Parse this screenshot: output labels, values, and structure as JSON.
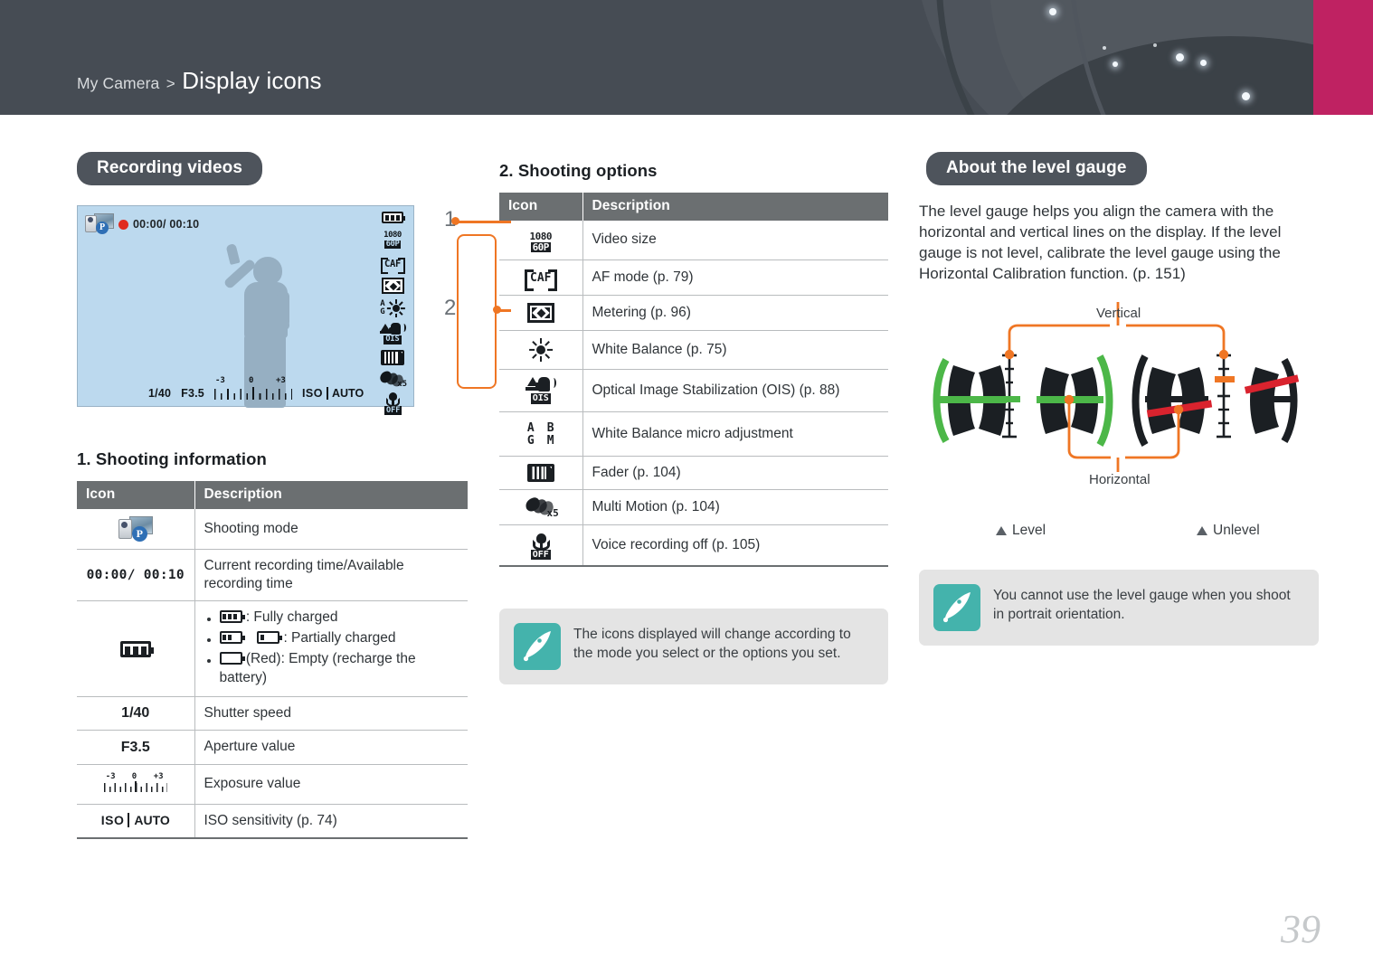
{
  "header": {
    "breadcrumb_parent": "My Camera",
    "breadcrumb_separator": ">",
    "breadcrumb_current": "Display icons",
    "bg_color": "#464c54",
    "accent_color": "#bf2262"
  },
  "page_number": "39",
  "col1": {
    "section_pill": "Recording videos",
    "lcd": {
      "rec_time": "00:00/ 00:10",
      "mode_badge": "P",
      "shutter": "1/40",
      "aperture": "F3.5",
      "ev_labels": [
        "-3",
        "0",
        "+3"
      ],
      "iso_prefix": "ISO",
      "iso_value": "AUTO",
      "right_icons": [
        "battery-icon",
        "video-size-1080-60p-icon",
        "af-mode-caf-icon",
        "metering-icon",
        "white-balance-daylight-icon",
        "ois-icon",
        "fader-icon",
        "multi-motion-x5-icon",
        "voice-recording-off-icon"
      ]
    },
    "callouts": [
      {
        "number": "1",
        "target": "battery-icon"
      },
      {
        "number": "2",
        "target": "shooting-options-icon-group"
      }
    ],
    "callout_color": "#ef7624",
    "subhead": "1. Shooting information",
    "table": {
      "headers": [
        "Icon",
        "Description"
      ],
      "rows": [
        {
          "icon": "shooting-mode-icon",
          "icon_text": "",
          "description": "Shooting mode"
        },
        {
          "icon": "recording-time-text",
          "icon_text": "00:00/ 00:10",
          "description": "Current recording time/Available recording time"
        },
        {
          "icon": "battery-icon",
          "icon_text": "",
          "bullets": [
            {
              "icons": [
                "battery-full-icon"
              ],
              "text": ": Fully charged"
            },
            {
              "icons": [
                "battery-mid-icon",
                "battery-low-icon"
              ],
              "text": ": Partially charged"
            },
            {
              "icons": [
                "battery-empty-icon"
              ],
              "text": "(Red): Empty (recharge the battery)"
            }
          ]
        },
        {
          "icon": "shutter-speed-text",
          "icon_text": "1/40",
          "description": "Shutter speed"
        },
        {
          "icon": "aperture-value-text",
          "icon_text": "F3.5",
          "description": "Aperture value"
        },
        {
          "icon": "exposure-value-scale-icon",
          "icon_text": "",
          "description": "Exposure value"
        },
        {
          "icon": "iso-sensitivity-icon",
          "icon_text": "ISO AUTO",
          "description": "ISO sensitivity (p. 74)"
        }
      ]
    }
  },
  "col2": {
    "subhead": "2. Shooting options",
    "table": {
      "headers": [
        "Icon",
        "Description"
      ],
      "rows": [
        {
          "icon": "video-size-1080-60p-icon",
          "description": "Video size"
        },
        {
          "icon": "af-mode-caf-icon",
          "description": "AF mode (p. 79)"
        },
        {
          "icon": "metering-icon",
          "description": "Metering (p. 96)"
        },
        {
          "icon": "white-balance-daylight-icon",
          "description": "White Balance (p. 75)"
        },
        {
          "icon": "ois-icon",
          "description": "Optical Image Stabilization (OIS) (p. 88)"
        },
        {
          "icon": "white-balance-micro-adjust-icon",
          "description": "White Balance micro adjustment"
        },
        {
          "icon": "fader-icon",
          "description": "Fader (p. 104)"
        },
        {
          "icon": "multi-motion-x5-icon",
          "description": "Multi Motion (p. 104)"
        },
        {
          "icon": "voice-recording-off-icon",
          "description": "Voice recording off (p. 105)"
        }
      ]
    },
    "note": {
      "icon": "pen-nib-icon",
      "text": "The icons displayed will change according to the mode you select or the options you set.",
      "icon_color": "#44b3ac"
    },
    "icon_labels": {
      "video_size_top": "1080",
      "video_size_bottom": "60P",
      "af_mode": "CAF",
      "ois_label": "OIS",
      "wb_micro": [
        "A",
        "B",
        "G",
        "M"
      ],
      "multi_motion_x": "x5",
      "mic_off": "OFF"
    }
  },
  "col3": {
    "section_pill": "About the level gauge",
    "paragraph": "The level gauge helps you align the camera with the horizontal and vertical lines on the display. If the level gauge is not level, calibrate the level gauge using the Horizontal Calibration function. (p. 151)",
    "diagram": {
      "label_vertical": "Vertical",
      "label_horizontal": "Horizontal",
      "level_color": "#4cb748",
      "unlevel_color": "#d9232e",
      "marker_color": "#ef7624",
      "neutral_color": "#1b1f23"
    },
    "captions": [
      {
        "label": "Level"
      },
      {
        "label": "Unlevel"
      }
    ],
    "note": {
      "icon": "pen-nib-icon",
      "text": "You cannot use the level gauge when you shoot in portrait orientation.",
      "icon_color": "#44b3ac"
    }
  }
}
